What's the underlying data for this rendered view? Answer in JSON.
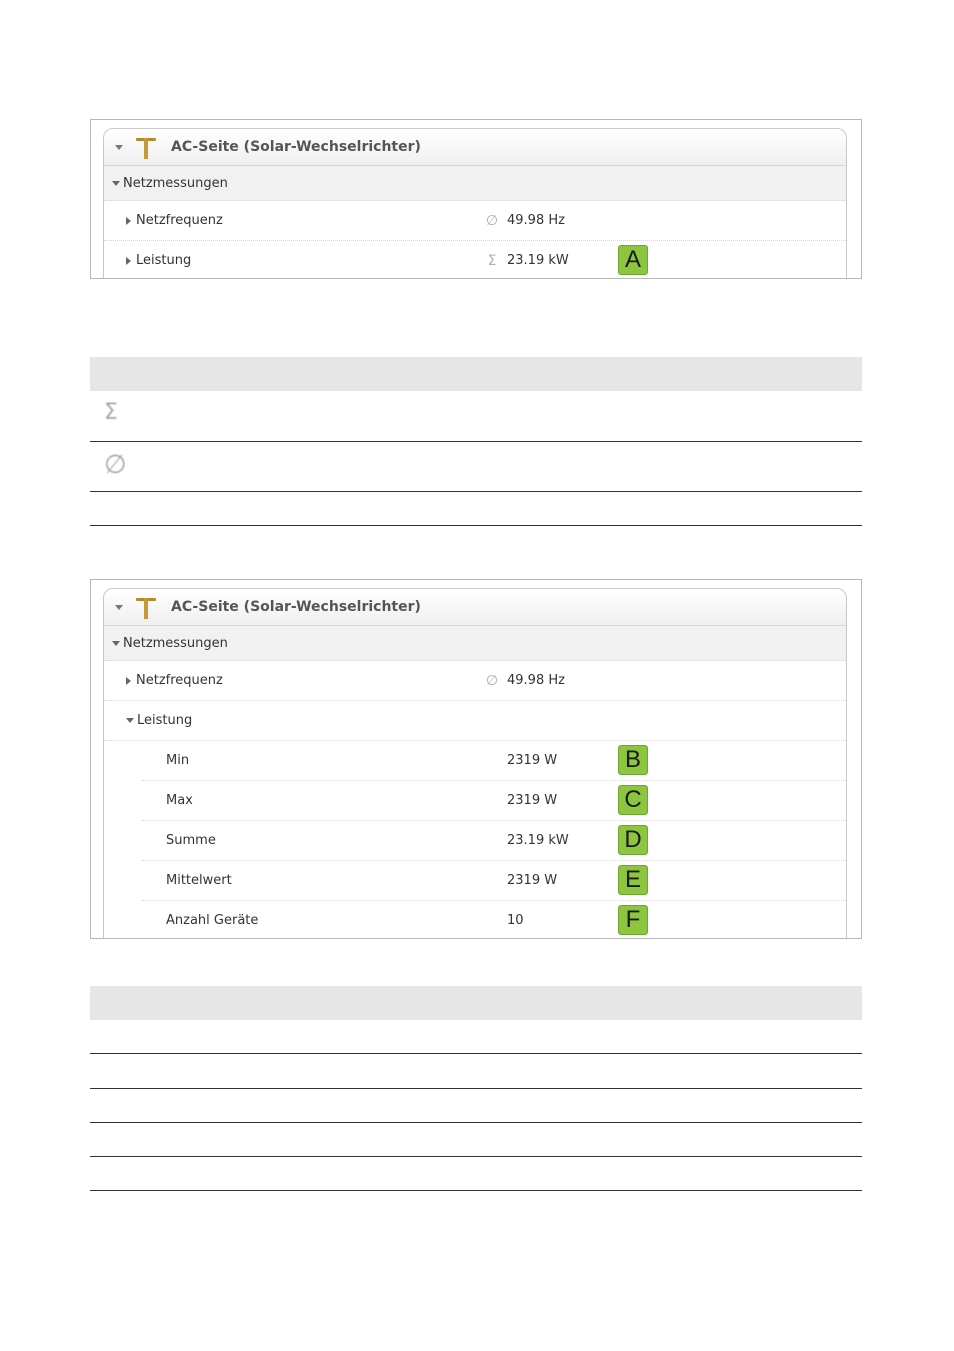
{
  "panel1": {
    "header": {
      "title": "AC-Seite (Solar-Wechselrichter)",
      "icon": "power-tower-icon"
    },
    "group": {
      "label": "Netzmessungen"
    },
    "rows": [
      {
        "label": "Netzfrequenz",
        "icon": "average-icon",
        "icon_glyph": "∅",
        "value": "49.98 Hz"
      },
      {
        "label": "Leistung",
        "icon": "sum-icon",
        "icon_glyph": "Σ",
        "value": "23.19 kW",
        "marker": "A"
      }
    ]
  },
  "legend1": {
    "rows": [
      {
        "icon": "sum-icon",
        "icon_glyph": "Σ"
      },
      {
        "icon": "average-icon",
        "icon_glyph": "∅"
      }
    ]
  },
  "panel2": {
    "header": {
      "title": "AC-Seite (Solar-Wechselrichter)",
      "icon": "power-tower-icon"
    },
    "group": {
      "label": "Netzmessungen"
    },
    "freq": {
      "label": "Netzfrequenz",
      "icon": "average-icon",
      "icon_glyph": "∅",
      "value": "49.98 Hz"
    },
    "power": {
      "label": "Leistung"
    },
    "details": [
      {
        "label": "Min",
        "value": "2319 W",
        "marker": "B"
      },
      {
        "label": "Max",
        "value": "2319 W",
        "marker": "C"
      },
      {
        "label": "Summe",
        "value": "23.19 kW",
        "marker": "D"
      },
      {
        "label": "Mittelwert",
        "value": "2319 W",
        "marker": "E"
      },
      {
        "label": "Anzahl Geräte",
        "value": "10",
        "marker": "F"
      }
    ]
  },
  "colors": {
    "marker": "#8cc63f",
    "table_header": "#e6e6e6",
    "icon_gold": "#c49a3a"
  }
}
